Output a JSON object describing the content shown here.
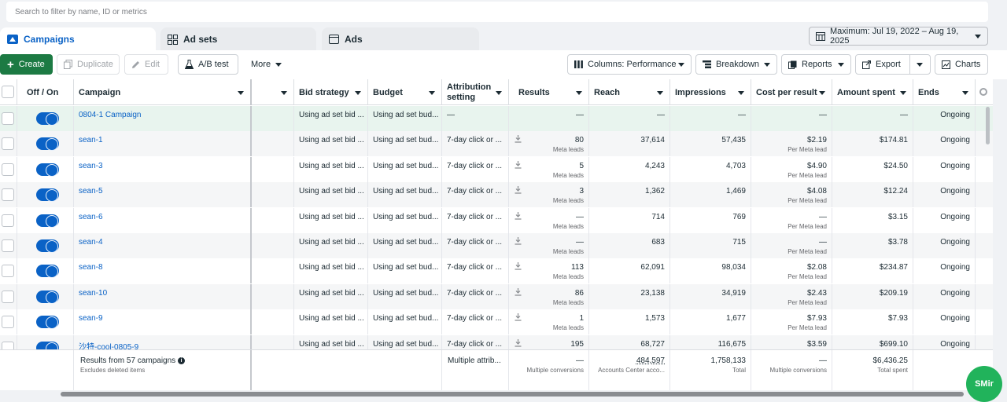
{
  "search": {
    "placeholder": "Search to filter by name, ID or metrics"
  },
  "tabs": [
    {
      "label": "Campaigns",
      "icon": "folder-icon"
    },
    {
      "label": "Ad sets",
      "icon": "grid-icon"
    },
    {
      "label": "Ads",
      "icon": "ad-icon"
    }
  ],
  "date_range": {
    "label": "Maximum: Jul 19, 2022 – Aug 19, 2025"
  },
  "toolbar": {
    "create": "Create",
    "duplicate": "Duplicate",
    "edit": "Edit",
    "ab_test": "A/B test",
    "more": "More",
    "columns": "Columns: Performance",
    "breakdown": "Breakdown",
    "reports": "Reports",
    "export": "Export",
    "charts": "Charts"
  },
  "columns": {
    "off_on": "Off / On",
    "campaign": "Campaign",
    "bid_strategy": "Bid strategy",
    "budget": "Budget",
    "attribution": "Attribution setting",
    "results": "Results",
    "reach": "Reach",
    "impressions": "Impressions",
    "cost_per_result": "Cost per result",
    "amount_spent": "Amount spent",
    "ends": "Ends"
  },
  "rows": [
    {
      "name": "0804-1 Campaign",
      "bid": "Using ad set bid ...",
      "budget": "Using ad set bud...",
      "attr": "—",
      "results": "—",
      "results_sub": "",
      "reach": "—",
      "impressions": "—",
      "cpr": "—",
      "cpr_sub": "",
      "spent": "—",
      "ends": "Ongoing"
    },
    {
      "name": "sean-1",
      "bid": "Using ad set bid ...",
      "budget": "Using ad set bud...",
      "attr": "7-day click or ...",
      "results": "80",
      "results_sub": "Meta leads",
      "reach": "37,614",
      "impressions": "57,435",
      "cpr": "$2.19",
      "cpr_sub": "Per Meta lead",
      "spent": "$174.81",
      "ends": "Ongoing"
    },
    {
      "name": "sean-3",
      "bid": "Using ad set bid ...",
      "budget": "Using ad set bud...",
      "attr": "7-day click or ...",
      "results": "5",
      "results_sub": "Meta leads",
      "reach": "4,243",
      "impressions": "4,703",
      "cpr": "$4.90",
      "cpr_sub": "Per Meta lead",
      "spent": "$24.50",
      "ends": "Ongoing"
    },
    {
      "name": "sean-5",
      "bid": "Using ad set bid ...",
      "budget": "Using ad set bud...",
      "attr": "7-day click or ...",
      "results": "3",
      "results_sub": "Meta leads",
      "reach": "1,362",
      "impressions": "1,469",
      "cpr": "$4.08",
      "cpr_sub": "Per Meta lead",
      "spent": "$12.24",
      "ends": "Ongoing"
    },
    {
      "name": "sean-6",
      "bid": "Using ad set bid ...",
      "budget": "Using ad set bud...",
      "attr": "7-day click or ...",
      "results": "—",
      "results_sub": "Meta leads",
      "reach": "714",
      "impressions": "769",
      "cpr": "—",
      "cpr_sub": "Per Meta lead",
      "spent": "$3.15",
      "ends": "Ongoing"
    },
    {
      "name": "sean-4",
      "bid": "Using ad set bid ...",
      "budget": "Using ad set bud...",
      "attr": "7-day click or ...",
      "results": "—",
      "results_sub": "Meta leads",
      "reach": "683",
      "impressions": "715",
      "cpr": "—",
      "cpr_sub": "Per Meta lead",
      "spent": "$3.78",
      "ends": "Ongoing"
    },
    {
      "name": "sean-8",
      "bid": "Using ad set bid ...",
      "budget": "Using ad set bud...",
      "attr": "7-day click or ...",
      "results": "113",
      "results_sub": "Meta leads",
      "reach": "62,091",
      "impressions": "98,034",
      "cpr": "$2.08",
      "cpr_sub": "Per Meta lead",
      "spent": "$234.87",
      "ends": "Ongoing"
    },
    {
      "name": "sean-10",
      "bid": "Using ad set bid ...",
      "budget": "Using ad set bud...",
      "attr": "7-day click or ...",
      "results": "86",
      "results_sub": "Meta leads",
      "reach": "23,138",
      "impressions": "34,919",
      "cpr": "$2.43",
      "cpr_sub": "Per Meta lead",
      "spent": "$209.19",
      "ends": "Ongoing"
    },
    {
      "name": "sean-9",
      "bid": "Using ad set bid ...",
      "budget": "Using ad set bud...",
      "attr": "7-day click or ...",
      "results": "1",
      "results_sub": "Meta leads",
      "reach": "1,573",
      "impressions": "1,677",
      "cpr": "$7.93",
      "cpr_sub": "Per Meta lead",
      "spent": "$7.93",
      "ends": "Ongoing"
    },
    {
      "name": "沙特-cool-0805-9",
      "bid": "Using ad set bid ...",
      "budget": "Using ad set bud...",
      "attr": "7-day click or ...",
      "results": "195",
      "results_sub": "",
      "reach": "68,727",
      "impressions": "116,675",
      "cpr": "$3.59",
      "cpr_sub": "",
      "spent": "$699.10",
      "ends": "Ongoing"
    }
  ],
  "footer": {
    "summary": "Results from 57 campaigns",
    "summary_sub": "Excludes deleted items",
    "attr": "Multiple attrib...",
    "results": "—",
    "results_sub": "Multiple conversions",
    "reach": "484,597",
    "reach_sub": "Accounts Center acco...",
    "impressions": "1,758,133",
    "impressions_sub": "Total",
    "cpr": "—",
    "cpr_sub": "Multiple conversions",
    "spent": "$6,436.25",
    "spent_sub": "Total spent"
  },
  "badge": "SMir",
  "colors": {
    "accent": "#0a62c6",
    "create_green": "#1c7a43",
    "badge_green": "#21b35b"
  }
}
